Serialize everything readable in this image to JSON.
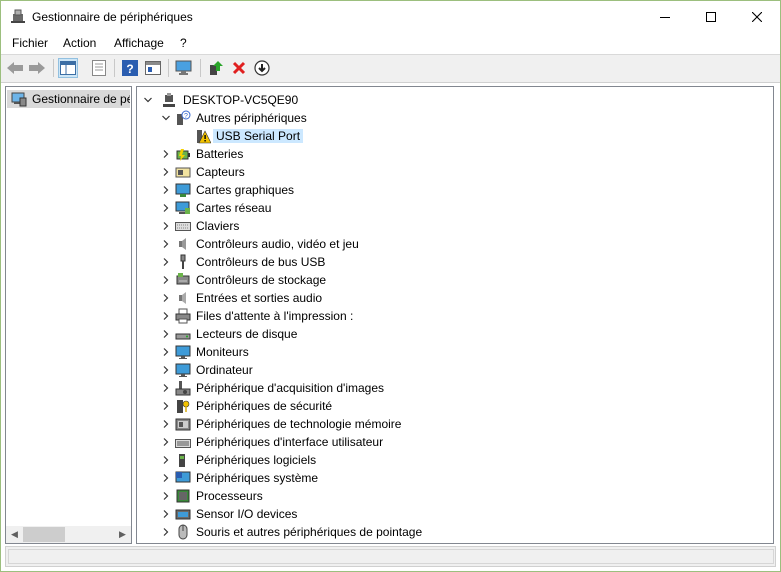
{
  "window": {
    "title": "Gestionnaire de périphériques",
    "controls": {
      "minimize_icon": "minimize-icon",
      "maximize_icon": "maximize-icon",
      "close_icon": "close-icon"
    }
  },
  "menu": [
    "Fichier",
    "Action",
    "Affichage",
    "?"
  ],
  "toolbar": {
    "icons": [
      "back-arrow-icon",
      "forward-arrow-icon",
      "show-tree-icon",
      "properties-sheet-icon",
      "help-icon",
      "view-icon",
      "monitor-scan-icon",
      "update-driver-icon",
      "uninstall-icon",
      "disable-device-icon"
    ],
    "uninstall_color": "#e02020",
    "update_color": "#2aa52a"
  },
  "left_pane": {
    "item_label": "Gestionnaire de pé"
  },
  "tree": {
    "root": "DESKTOP-VC5QE90",
    "expanded_category": "Autres périphériques",
    "selected_device": "USB Serial Port",
    "warning_color": "#f2c200",
    "categories": [
      {
        "label": "Batteries",
        "icon": "battery-icon"
      },
      {
        "label": "Capteurs",
        "icon": "sensor-icon"
      },
      {
        "label": "Cartes graphiques",
        "icon": "display-adapter-icon"
      },
      {
        "label": "Cartes réseau",
        "icon": "network-adapter-icon"
      },
      {
        "label": "Claviers",
        "icon": "keyboard-icon"
      },
      {
        "label": "Contrôleurs audio, vidéo et jeu",
        "icon": "speaker-icon"
      },
      {
        "label": "Contrôleurs de bus USB",
        "icon": "usb-icon"
      },
      {
        "label": "Contrôleurs de stockage",
        "icon": "storage-controller-icon"
      },
      {
        "label": "Entrées et sorties audio",
        "icon": "audio-io-icon"
      },
      {
        "label": "Files d'attente à l'impression :",
        "icon": "printer-icon"
      },
      {
        "label": "Lecteurs de disque",
        "icon": "disk-drive-icon"
      },
      {
        "label": "Moniteurs",
        "icon": "monitor-icon"
      },
      {
        "label": "Ordinateur",
        "icon": "computer-icon"
      },
      {
        "label": "Périphérique d'acquisition d'images",
        "icon": "camera-icon"
      },
      {
        "label": "Périphériques de sécurité",
        "icon": "security-key-icon"
      },
      {
        "label": "Périphériques de technologie mémoire",
        "icon": "memory-icon"
      },
      {
        "label": "Périphériques d'interface utilisateur",
        "icon": "hid-icon"
      },
      {
        "label": "Périphériques logiciels",
        "icon": "software-device-icon"
      },
      {
        "label": "Périphériques système",
        "icon": "system-device-icon"
      },
      {
        "label": "Processeurs",
        "icon": "processor-icon"
      },
      {
        "label": "Sensor I/O devices",
        "icon": "sensor-io-icon"
      },
      {
        "label": "Souris et autres périphériques de pointage",
        "icon": "mouse-icon"
      }
    ]
  }
}
